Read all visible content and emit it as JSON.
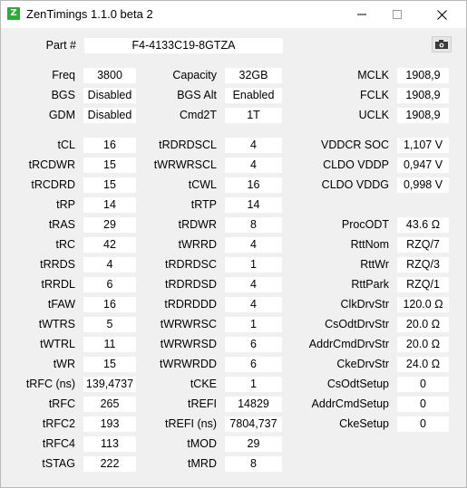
{
  "window": {
    "title": "ZenTimings 1.1.0 beta 2",
    "icon_letter": "Z",
    "accent": "#2eaa3a"
  },
  "part": {
    "label": "Part #",
    "value": "F4-4133C19-8GTZA"
  },
  "general": [
    {
      "label": "Freq",
      "value": "3800"
    },
    {
      "label": "BGS",
      "value": "Disabled"
    },
    {
      "label": "GDM",
      "value": "Disabled"
    },
    {
      "label": "Capacity",
      "value": "32GB"
    },
    {
      "label": "BGS Alt",
      "value": "Enabled"
    },
    {
      "label": "Cmd2T",
      "value": "1T"
    },
    {
      "label": "MCLK",
      "value": "1908,9"
    },
    {
      "label": "FCLK",
      "value": "1908,9"
    },
    {
      "label": "UCLK",
      "value": "1908,9"
    }
  ],
  "col1": [
    {
      "label": "tCL",
      "value": "16"
    },
    {
      "label": "tRCDWR",
      "value": "15"
    },
    {
      "label": "tRCDRD",
      "value": "15"
    },
    {
      "label": "tRP",
      "value": "14"
    },
    {
      "label": "tRAS",
      "value": "29"
    },
    {
      "label": "tRC",
      "value": "42"
    },
    {
      "label": "tRRDS",
      "value": "4"
    },
    {
      "label": "tRRDL",
      "value": "6"
    },
    {
      "label": "tFAW",
      "value": "16"
    },
    {
      "label": "tWTRS",
      "value": "5"
    },
    {
      "label": "tWTRL",
      "value": "11"
    },
    {
      "label": "tWR",
      "value": "15"
    },
    {
      "label": "tRFC (ns)",
      "value": "139,4737"
    },
    {
      "label": "tRFC",
      "value": "265"
    },
    {
      "label": "tRFC2",
      "value": "193"
    },
    {
      "label": "tRFC4",
      "value": "113"
    },
    {
      "label": "tSTAG",
      "value": "222"
    }
  ],
  "col2": [
    {
      "label": "tRDRDSCL",
      "value": "4"
    },
    {
      "label": "tWRWRSCL",
      "value": "4"
    },
    {
      "label": "tCWL",
      "value": "16"
    },
    {
      "label": "tRTP",
      "value": "14"
    },
    {
      "label": "tRDWR",
      "value": "8"
    },
    {
      "label": "tWRRD",
      "value": "4"
    },
    {
      "label": "tRDRDSC",
      "value": "1"
    },
    {
      "label": "tRDRDSD",
      "value": "4"
    },
    {
      "label": "tRDRDDD",
      "value": "4"
    },
    {
      "label": "tWRWRSC",
      "value": "1"
    },
    {
      "label": "tWRWRSD",
      "value": "6"
    },
    {
      "label": "tWRWRDD",
      "value": "6"
    },
    {
      "label": "tCKE",
      "value": "1"
    },
    {
      "label": "tREFI",
      "value": "14829"
    },
    {
      "label": "tREFI (ns)",
      "value": "7804,737"
    },
    {
      "label": "tMOD",
      "value": "29"
    },
    {
      "label": "tMRD",
      "value": "8"
    }
  ],
  "col3": [
    {
      "label": "VDDCR SOC",
      "value": "1,107 V"
    },
    {
      "label": "CLDO VDDP",
      "value": "0,947 V"
    },
    {
      "label": "CLDO VDDG",
      "value": "0,998 V"
    },
    {
      "label": "ProcODT",
      "value": "43.6 Ω"
    },
    {
      "label": "RttNom",
      "value": "RZQ/7"
    },
    {
      "label": "RttWr",
      "value": "RZQ/3"
    },
    {
      "label": "RttPark",
      "value": "RZQ/1"
    },
    {
      "label": "ClkDrvStr",
      "value": "120.0 Ω"
    },
    {
      "label": "CsOdtDrvStr",
      "value": "20.0 Ω"
    },
    {
      "label": "AddrCmdDrvStr",
      "value": "20.0 Ω"
    },
    {
      "label": "CkeDrvStr",
      "value": "24.0 Ω"
    },
    {
      "label": "CsOdtSetup",
      "value": "0"
    },
    {
      "label": "AddrCmdSetup",
      "value": "0"
    },
    {
      "label": "CkeSetup",
      "value": "0"
    }
  ],
  "icons": {
    "app": "zentimings-app-icon",
    "minimize": "minimize-icon",
    "maximize": "maximize-icon",
    "close": "close-icon",
    "screenshot": "camera-icon"
  }
}
